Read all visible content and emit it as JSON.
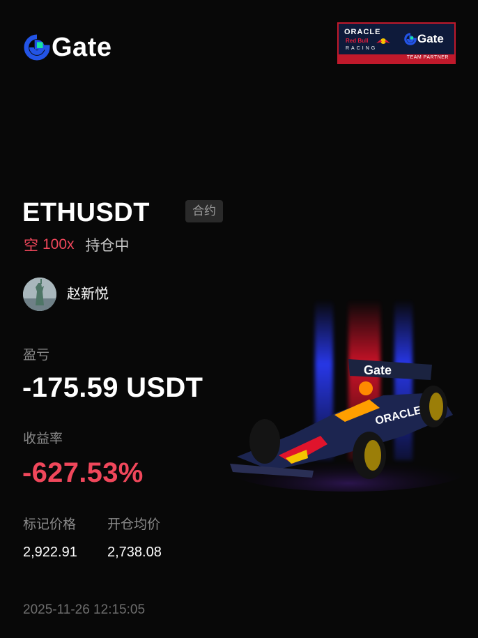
{
  "brand": {
    "logo_text": "Gate",
    "accent": "#2354e6",
    "accent2": "#17e6a1"
  },
  "partner": {
    "oracle": "ORACLE",
    "redbull": "Red Bull",
    "racing": "RACING",
    "gate": "Gate",
    "strip": "TEAM PARTNER"
  },
  "position": {
    "pair": "ETHUSDT",
    "type_tag": "合约",
    "side": "空",
    "leverage": "100x",
    "status": "持仓中"
  },
  "user": {
    "name": "赵新悦",
    "avatar_icon": "statue-of-liberty-avatar"
  },
  "metrics": {
    "pnl_label": "盈亏",
    "pnl_value": "-175.59 USDT",
    "roi_label": "收益率",
    "roi_value": "-627.53%",
    "mark_price_label": "标记价格",
    "mark_price_value": "2,922.91",
    "entry_price_label": "开仓均价",
    "entry_price_value": "2,738.08"
  },
  "timestamp": "2025-11-26 12:15:05",
  "colors": {
    "background": "#080808",
    "loss": "#f0475b",
    "muted": "#8a8a8a"
  }
}
